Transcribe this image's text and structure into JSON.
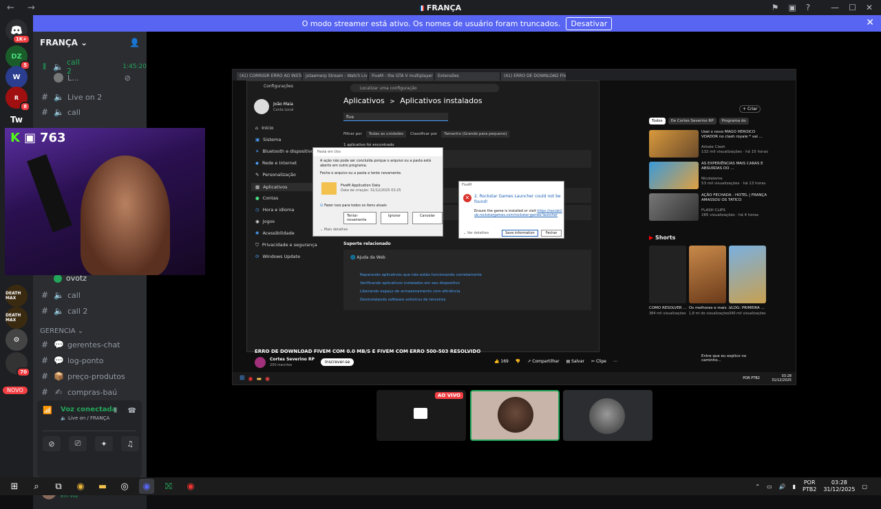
{
  "titlebar": {
    "title": "FRANÇA"
  },
  "banner": {
    "text": "O modo streamer está ativo. Os nomes de usuário foram truncados.",
    "button": "Desativar"
  },
  "server": {
    "name": "FRANÇA"
  },
  "servers": [
    {
      "label": "1K+",
      "badge": "1K+"
    },
    {
      "label": "5",
      "badge": "5"
    },
    {
      "label": "W",
      "badge": ""
    },
    {
      "label": "8",
      "badge": "8"
    },
    {
      "label": "Tw",
      "badge": ""
    }
  ],
  "channels": {
    "call2": {
      "name": "call 2",
      "timer": "1:45:20"
    },
    "member": "L...",
    "live_on_2": "Live on 2",
    "call": "call",
    "ovotz": "ovotz",
    "call_b": "call",
    "call2_b": "call 2",
    "category": "GERENCIA",
    "text": [
      "gerentes-chat",
      "log-ponto",
      "preço-produtos",
      "compras-baú"
    ],
    "novo": "NOVO"
  },
  "voice": {
    "status": "Voz conectada",
    "sub": "Live on / FRANÇA"
  },
  "user": {
    "name": "ovotz",
    "status": "Em voz"
  },
  "webcam": {
    "count": "763"
  },
  "shared": {
    "tabs": [
      "(41) CORRIGIR ERRO AO INSTA",
      "jotaemerp Stream - Watch Liv",
      "FiveM - the GTA V multiplayer",
      "Extensões",
      "(41) ERRO DE DOWNLOAD FIV"
    ],
    "settings": {
      "title": "Configurações",
      "search": "Localizar uma configuração",
      "user_name": "João Maia",
      "user_sub": "Conta Local",
      "breadcrumb_a": "Aplicativos",
      "breadcrumb_sep": ">",
      "breadcrumb_b": "Aplicativos instalados",
      "filter_search": "five",
      "filter_label": "Filtrar por",
      "filter_value": "Todas as unidades",
      "sort_label": "Classificar por",
      "sort_value": "Tamanho (Grande para pequeno)",
      "found": "1 aplicativo foi encontrado",
      "side": [
        "Início",
        "Sistema",
        "Bluetooth e dispositivos",
        "Rede e Internet",
        "Personalização",
        "Aplicativos",
        "Contas",
        "Hora e idioma",
        "Jogos",
        "Acessibilidade",
        "Privacidade e segurança",
        "Windows Update"
      ],
      "support": "Suporte relacionado",
      "web_help": "Ajuda da Web",
      "links": [
        "Reparando aplicativos que não estão funcionando corretamente",
        "Verificando aplicativos instalados em seu dispositivo",
        "Liberando espaço de armazenamento com eficiência",
        "Desinstalando software antivírus de terceiros"
      ]
    },
    "dialog1": {
      "title": "Pasta em Uso",
      "msg": "A ação não pode ser concluída porque o arquivo ou a pasta está aberto em outro programa.",
      "msg2": "Feche o arquivo ou a pasta e tente novamente.",
      "file": "FiveM Application Data",
      "date": "Data de criação: 31/12/2025 03:25",
      "checkbox": "Fazer isso para todos os itens atuais",
      "btn1": "Tentar novamente",
      "btn2": "Ignorar",
      "btn3": "Cancelar",
      "more": "Mais detalhes"
    },
    "dialog2": {
      "title": "FiveM",
      "msg": "2. Rockstar Games Launcher could not be found!",
      "sub": "Ensure the game is installed or visit",
      "link": "https://socialclub.rockstargames.com/rockstar-games-launcher",
      "details": "Ver detalhes",
      "btn1": "Save information",
      "btn2": "Fechar"
    },
    "youtube": {
      "chips": [
        "Todos",
        "De Cortes Severino RP",
        "Programa do"
      ],
      "videos": [
        {
          "title": "Usei o novo MAGO HEROICO VOADOR no clash royale * vai ...",
          "channel": "Arbale Clash",
          "meta": "132 mil visualizações · há 15 horas",
          "dur": "18:35"
        },
        {
          "title": "AS EXPERIÊNCIAS MAIS CARAS E ABSURDAS DO ...",
          "channel": "Nicoleleme",
          "meta": "53 mil visualizações · há 13 horas",
          "dur": "36:26"
        },
        {
          "title": "AÇÃO FECHADA - HOTEL | FRANÇA AMASSOU OS TATICO",
          "channel": "FLASH CLIPS",
          "meta": "285 visualizações · há 4 horas",
          "dur": "3:04"
        }
      ],
      "shorts": "Shorts",
      "short_items": [
        {
          "title": "COMO RESOLVER ...",
          "meta": "384 mil visualizações"
        },
        {
          "title": "Os melhores e mais ...",
          "meta": "1,8 mi de visualizações"
        },
        {
          "title": "VLOG: PRIMEIRA ...",
          "meta": "340 mil visualizações"
        }
      ],
      "video_title": "ERRO DE DOWNLOAD FIVEM COM 0.0 MB/S E FIVEM COM ERRO 500-503 RESOLVIDO",
      "channel": "Cortes Severino RP",
      "subs": "200 inscritos",
      "subscribe": "Inscrever-se",
      "likes": "169",
      "share": "Compartilhar",
      "save": "Salvar",
      "clip": "Clipe",
      "create": "Criar",
      "comment": "Entre que eu explico no caminho..."
    },
    "inner_clock": {
      "time": "03:28",
      "date": "31/12/2025",
      "lang": "POR PTB2"
    }
  },
  "tiles": {
    "live_badge": "AO VIVO"
  },
  "tray": {
    "lang1": "POR",
    "lang2": "PTB2",
    "time": "03:28",
    "date": "31/12/2025"
  }
}
